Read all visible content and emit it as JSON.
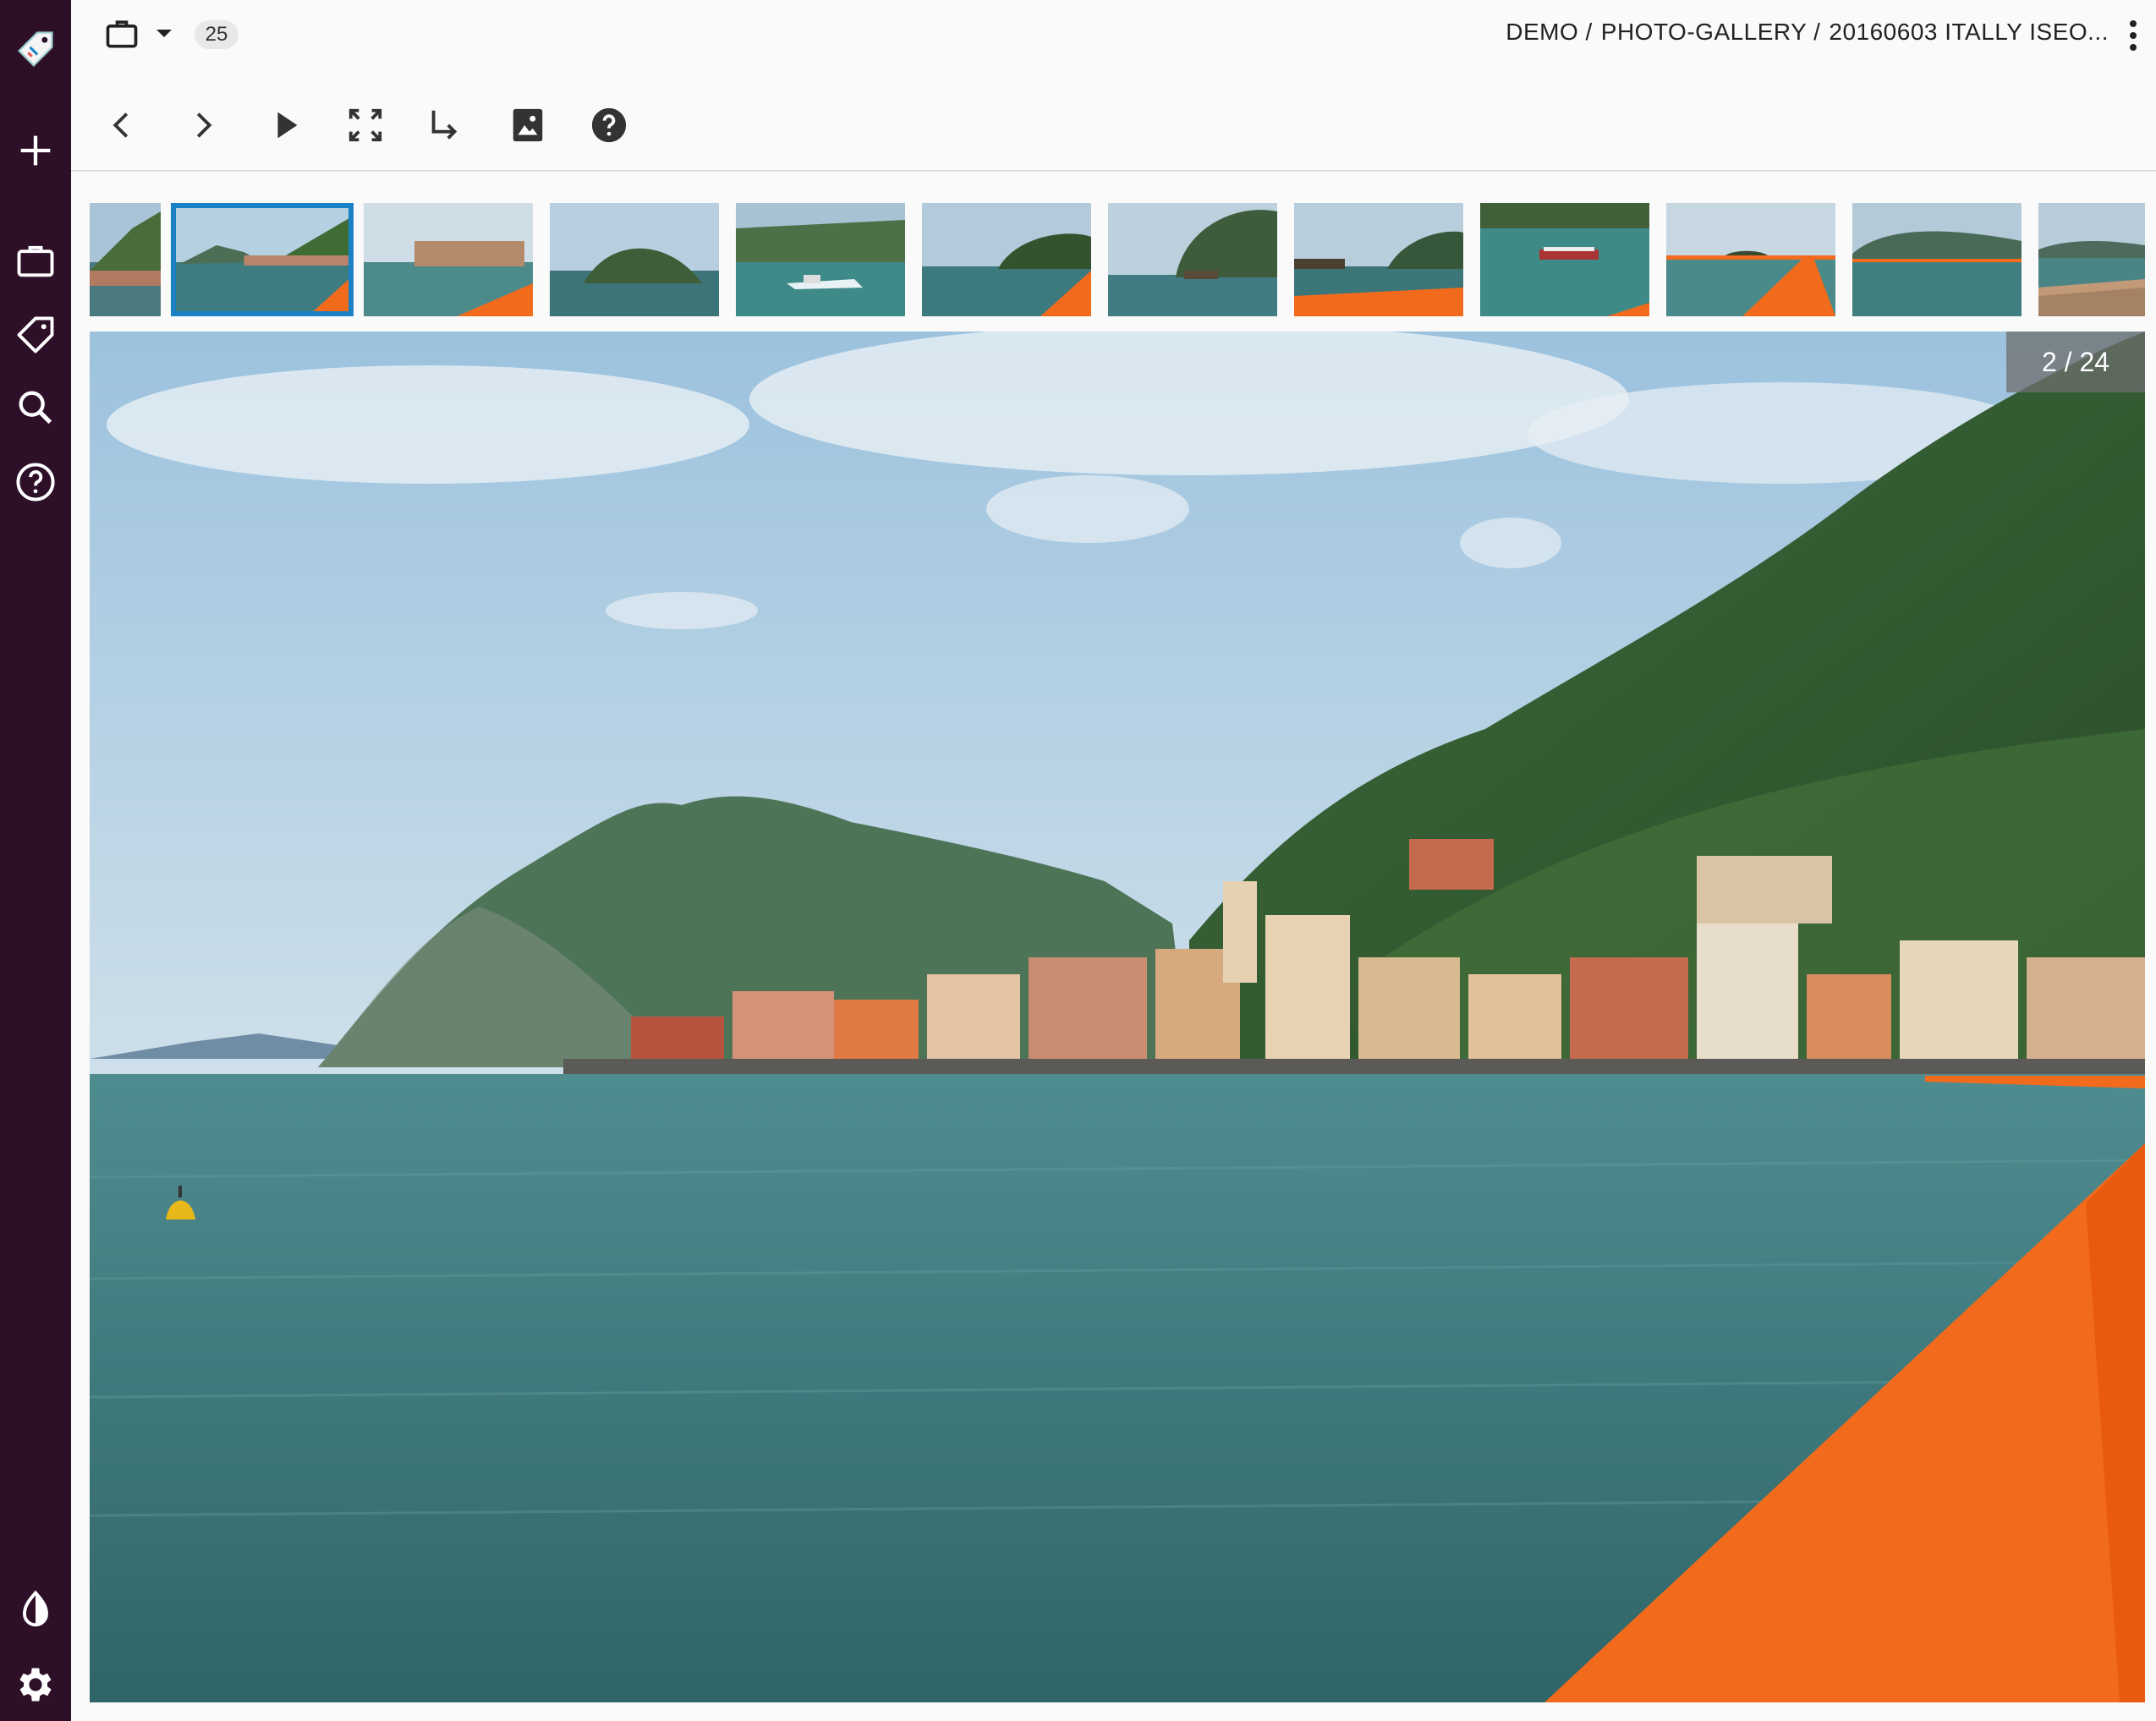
{
  "sidebar": {
    "logo": "tag-logo-icon",
    "items": [
      {
        "icon": "plus-icon"
      },
      {
        "icon": "briefcase-icon"
      },
      {
        "icon": "tag-icon"
      },
      {
        "icon": "search-icon"
      },
      {
        "icon": "help-circle-icon"
      }
    ],
    "bottom": [
      {
        "icon": "contrast-icon"
      },
      {
        "icon": "gear-icon"
      }
    ]
  },
  "topbar": {
    "workspace_icon": "briefcase-icon",
    "count": "25",
    "breadcrumb": [
      "DEMO /",
      "PHOTO-GALLERY /",
      "20160603 ITALLY ISEO..."
    ],
    "menu_icon": "more-vertical-icon"
  },
  "toolbar": {
    "buttons": [
      "chevron-left-icon",
      "chevron-right-icon",
      "play-icon",
      "fullscreen-icon",
      "subdirectory-arrow-icon",
      "image-icon",
      "help-icon"
    ]
  },
  "viewer": {
    "counter": "2 / 24",
    "current_index": 2,
    "total": 24
  },
  "colors": {
    "sidebar_bg": "#2d0f28",
    "selection": "#1a82c4",
    "float_orange": "#f26b1d"
  }
}
